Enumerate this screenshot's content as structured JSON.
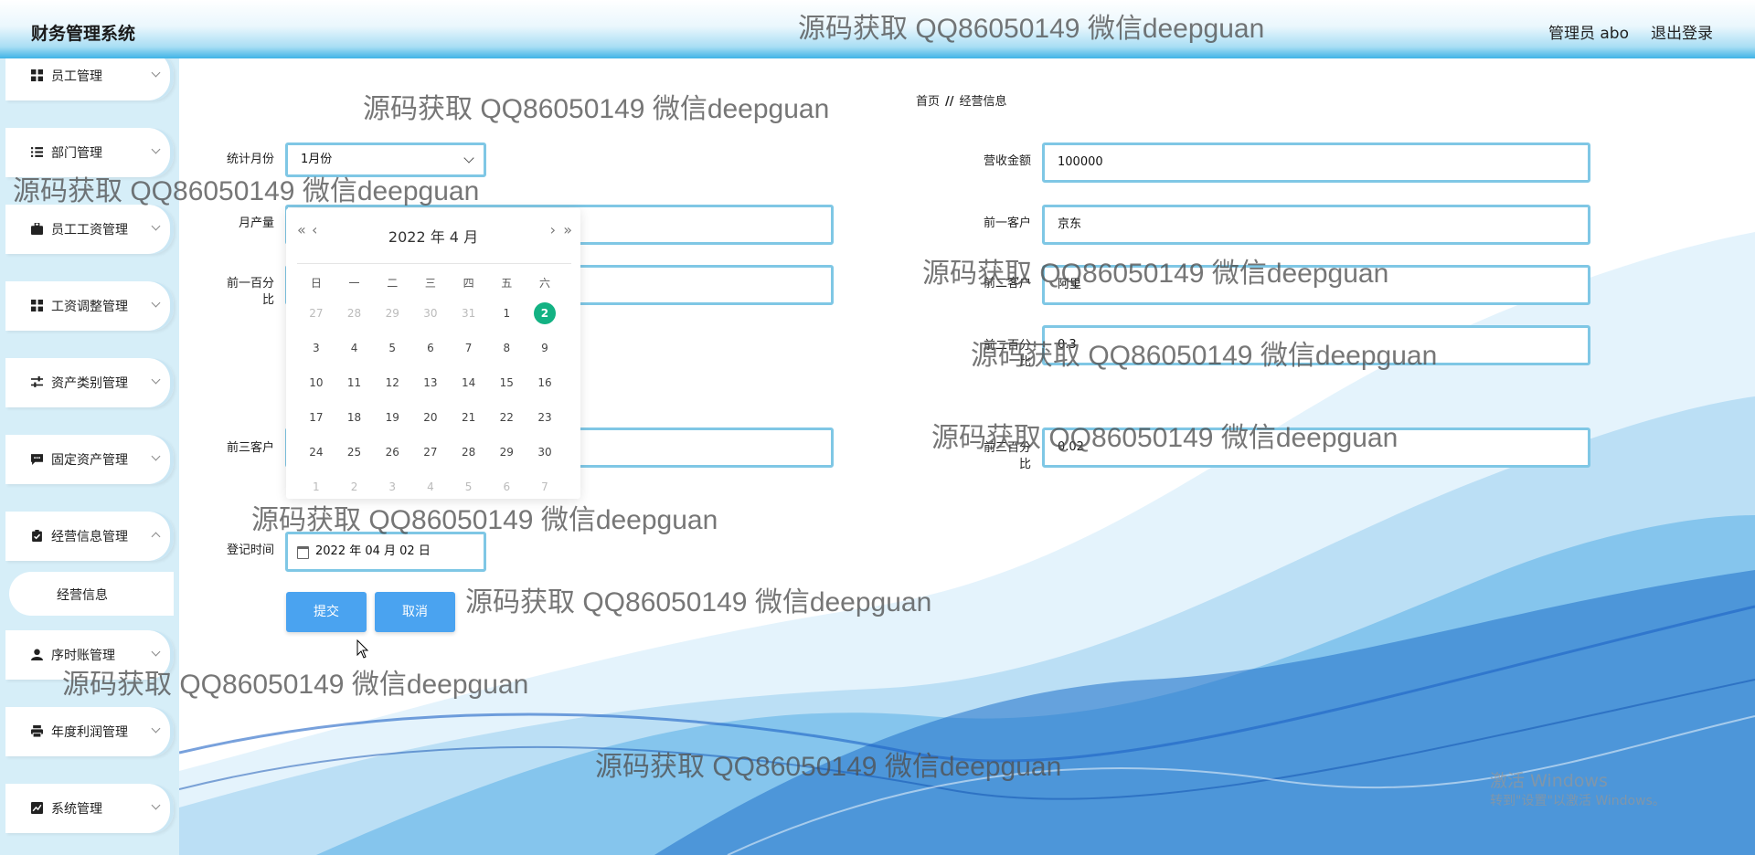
{
  "header": {
    "app_title": "财务管理系统",
    "admin_label": "管理员 abo",
    "logout": "退出登录"
  },
  "sidebar": {
    "items": [
      {
        "label": "员工管理",
        "icon": "grid-icon"
      },
      {
        "label": "部门管理",
        "icon": "list-icon"
      },
      {
        "label": "员工工资管理",
        "icon": "briefcase-icon"
      },
      {
        "label": "工资调整管理",
        "icon": "grid-icon"
      },
      {
        "label": "资产类别管理",
        "icon": "sliders-icon"
      },
      {
        "label": "固定资产管理",
        "icon": "chat-icon"
      },
      {
        "label": "经营信息管理",
        "icon": "clipboard-check-icon"
      },
      {
        "label": "序时账管理",
        "icon": "user-icon"
      },
      {
        "label": "年度利润管理",
        "icon": "printer-icon"
      },
      {
        "label": "系统管理",
        "icon": "chart-icon"
      }
    ],
    "active_sub": "经营信息"
  },
  "breadcrumb": {
    "home": "首页",
    "separator": "//",
    "current": "经营信息"
  },
  "form": {
    "month_label": "统计月份",
    "month_value": "1月份",
    "output_label": "月产量",
    "first_pct_label_1": "前一百分",
    "first_pct_label_2": "比",
    "third_customer_label": "前三客户",
    "reg_time_label": "登记时间",
    "reg_time_value": "2022 年 04 月 02 日",
    "revenue_label": "营收金额",
    "revenue_value": "100000",
    "first_customer_label": "前一客户",
    "first_customer_value": "京东",
    "second_customer_label": "前二客户",
    "second_customer_value": "阿里",
    "second_pct_label_1": "前二百分",
    "second_pct_label_2": "比",
    "second_pct_value": "0.3",
    "third_pct_label_1": "前三百分",
    "third_pct_label_2": "比",
    "third_pct_value": "0.02",
    "submit": "提交",
    "cancel": "取消"
  },
  "datepicker": {
    "title": "2022 年  4 月",
    "prev_year": "«",
    "prev_month": "‹",
    "next_month": "›",
    "next_year": "»",
    "weekdays": [
      "日",
      "一",
      "二",
      "三",
      "四",
      "五",
      "六"
    ],
    "weeks": [
      [
        "27",
        "28",
        "29",
        "30",
        "31",
        "1",
        "2"
      ],
      [
        "3",
        "4",
        "5",
        "6",
        "7",
        "8",
        "9"
      ],
      [
        "10",
        "11",
        "12",
        "13",
        "14",
        "15",
        "16"
      ],
      [
        "17",
        "18",
        "19",
        "20",
        "21",
        "22",
        "23"
      ],
      [
        "24",
        "25",
        "26",
        "27",
        "28",
        "29",
        "30"
      ],
      [
        "1",
        "2",
        "3",
        "4",
        "5",
        "6",
        "7"
      ]
    ],
    "selected": "2"
  },
  "watermark": "源码获取 QQ86050149 微信deepguan",
  "windows_activation": {
    "line1": "激活 Windows",
    "line2": "转到\"设置\"以激活 Windows。"
  }
}
